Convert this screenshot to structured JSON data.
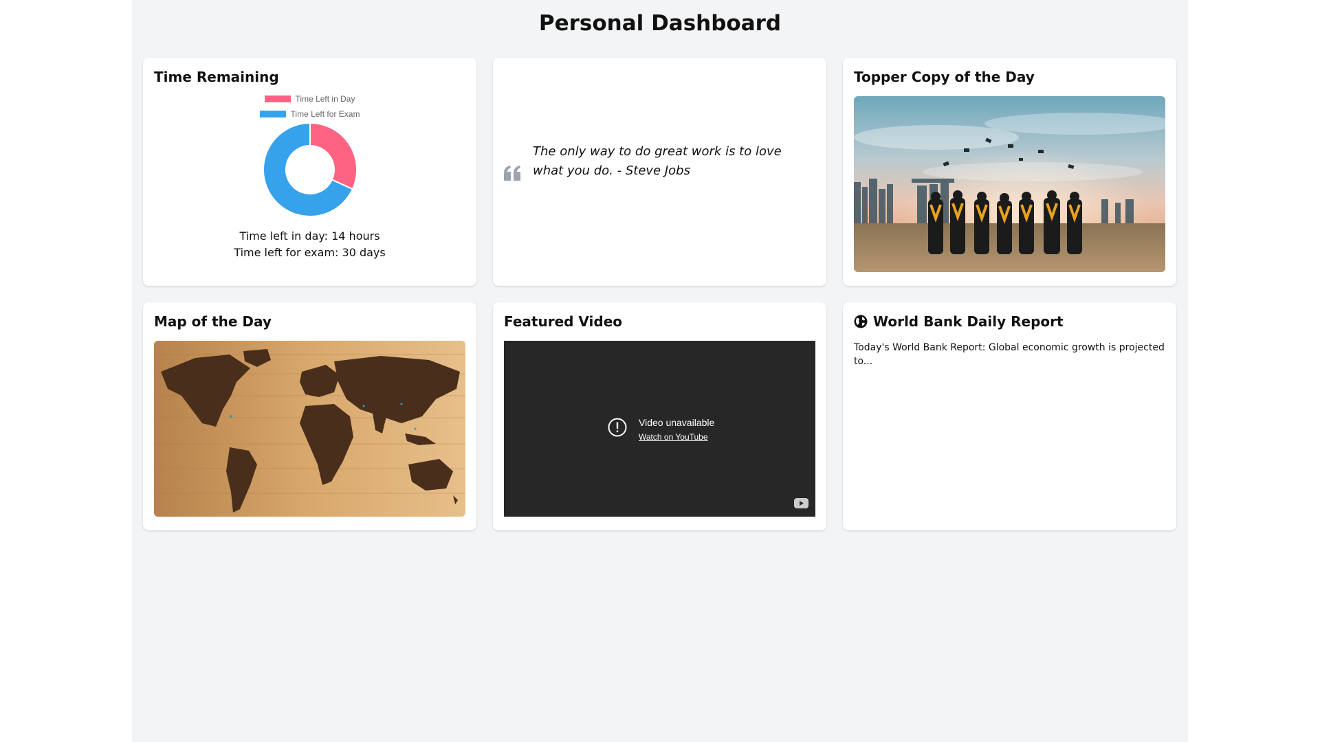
{
  "page": {
    "title": "Personal Dashboard"
  },
  "time_card": {
    "title": "Time Remaining",
    "legend": [
      {
        "label": "Time Left in Day",
        "color": "#ff6384"
      },
      {
        "label": "Time Left for Exam",
        "color": "#36a2eb"
      }
    ],
    "day_text": "Time left in day: 14 hours",
    "exam_text": "Time left for exam: 30 days"
  },
  "chart_data": {
    "type": "pie",
    "title": "",
    "categories": [
      "Time Left in Day",
      "Time Left for Exam"
    ],
    "values": [
      14,
      30
    ],
    "colors": [
      "#ff6384",
      "#36a2eb"
    ],
    "legend_position": "top"
  },
  "quote_card": {
    "icon": "quote-icon",
    "text": "The only way to do great work is to love what you do. - Steve Jobs"
  },
  "topper_card": {
    "title": "Topper Copy of the Day",
    "image": "graduates-photo"
  },
  "map_card": {
    "title": "Map of the Day",
    "image": "wooden-world-map"
  },
  "video_card": {
    "title": "Featured Video",
    "message": "Video unavailable",
    "link": "Watch on YouTube"
  },
  "report_card": {
    "icon": "globe-icon",
    "title": "World Bank Daily Report",
    "text": "Today's World Bank Report: Global economic growth is projected to..."
  }
}
